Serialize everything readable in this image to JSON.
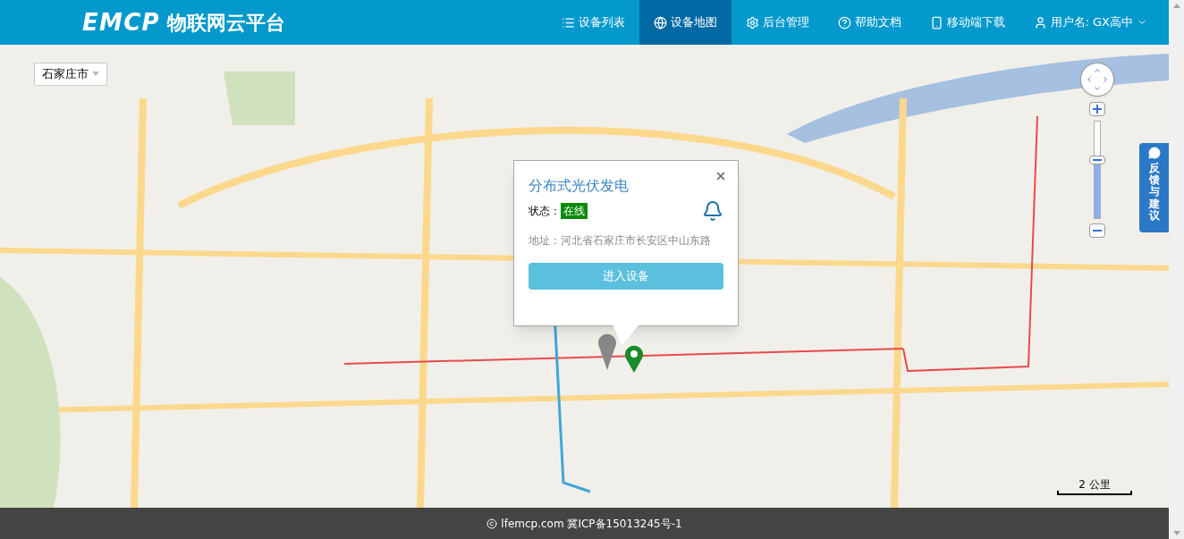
{
  "header": {
    "logo_latin": "EMCP",
    "logo_cn": "物联网云平台",
    "nav": [
      {
        "label": "设备列表",
        "kind": "link",
        "selected": false
      },
      {
        "label": "设备地图",
        "kind": "link",
        "selected": true
      },
      {
        "label": "后台管理",
        "kind": "link",
        "selected": false
      },
      {
        "label": "帮助文档",
        "kind": "link",
        "selected": false
      },
      {
        "label": "移动端下载",
        "kind": "link",
        "selected": false
      },
      {
        "label": "用户名: GX高中",
        "kind": "dropdown",
        "selected": false
      }
    ]
  },
  "map": {
    "city_selector": "石家庄市",
    "zoom": {
      "level": 0.6
    },
    "feedback": "反馈与建议",
    "scale": "2 公里",
    "popup": {
      "title": "分布式光伏发电",
      "status_label": "状态：",
      "status": "在线",
      "address": "地址：河北省石家庄市长安区中山东路",
      "button": "进入设备"
    }
  },
  "footer": {
    "text": "lfemcp.com 冀ICP备15013245号-1"
  }
}
